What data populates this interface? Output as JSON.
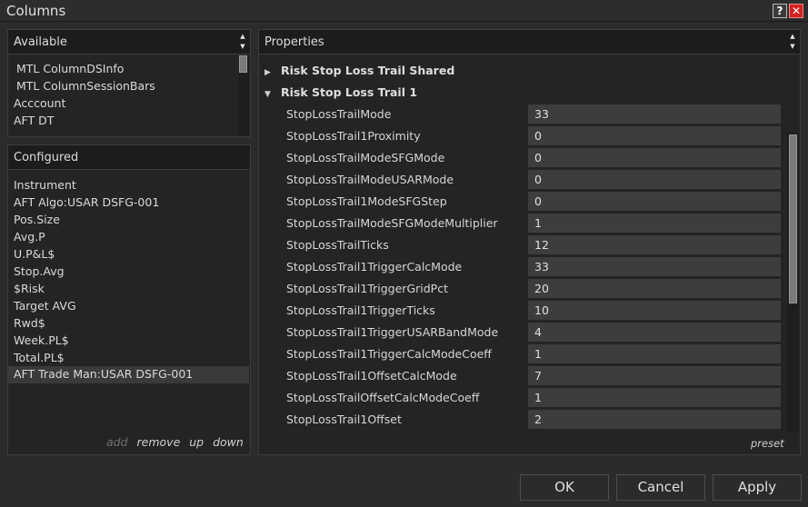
{
  "window": {
    "title": "Columns",
    "help_label": "?",
    "close_label": "✕"
  },
  "available": {
    "header": "Available",
    "items": [
      "MTL ColumnDSInfo",
      "MTL ColumnSessionBars",
      "Acccount",
      "AFT DT"
    ]
  },
  "configured": {
    "header": "Configured",
    "items": [
      "Instrument",
      "AFT Algo:USAR DSFG-001",
      "Pos.Size",
      "Avg.P",
      "U.P&L$",
      "Stop.Avg",
      "$Risk",
      "Target AVG",
      "Rwd$",
      "Week.PL$",
      "Total.PL$",
      "AFT Trade Man:USAR DSFG-001"
    ],
    "selected_index": 11,
    "actions": {
      "add": "add",
      "remove": "remove",
      "up": "up",
      "down": "down"
    }
  },
  "properties": {
    "header": "Properties",
    "categories": [
      {
        "label": "Risk Stop Loss Trail Shared",
        "expanded": false
      },
      {
        "label": "Risk Stop Loss Trail 1",
        "expanded": true
      }
    ],
    "rows": [
      {
        "name": "StopLossTrailMode",
        "value": "33"
      },
      {
        "name": "StopLossTrail1Proximity",
        "value": "0"
      },
      {
        "name": "StopLossTrailModeSFGMode",
        "value": "0"
      },
      {
        "name": "StopLossTrailModeUSARMode",
        "value": "0"
      },
      {
        "name": "StopLossTrail1ModeSFGStep",
        "value": "0"
      },
      {
        "name": "StopLossTrailModeSFGModeMultiplier",
        "value": "1"
      },
      {
        "name": "StopLossTrailTicks",
        "value": "12"
      },
      {
        "name": "StopLossTrail1TriggerCalcMode",
        "value": "33"
      },
      {
        "name": "StopLossTrail1TriggerGridPct",
        "value": "20"
      },
      {
        "name": "StopLossTrail1TriggerTicks",
        "value": "10"
      },
      {
        "name": "StopLossTrail1TriggerUSARBandMode",
        "value": "4"
      },
      {
        "name": "StopLossTrail1TriggerCalcModeCoeff",
        "value": "1"
      },
      {
        "name": "StopLossTrail1OffsetCalcMode",
        "value": "7"
      },
      {
        "name": "StopLossTrailOffsetCalcModeCoeff",
        "value": "1"
      },
      {
        "name": "StopLossTrail1Offset",
        "value": "2"
      }
    ],
    "preset_label": "preset"
  },
  "buttons": {
    "ok": "OK",
    "cancel": "Cancel",
    "apply": "Apply"
  },
  "icons": {
    "expanded": "triangle-down-icon",
    "collapsed": "triangle-right-icon"
  },
  "colors": {
    "background": "#2b2b2b",
    "close_button": "#d42222",
    "value_cell": "#3d3d3d"
  }
}
